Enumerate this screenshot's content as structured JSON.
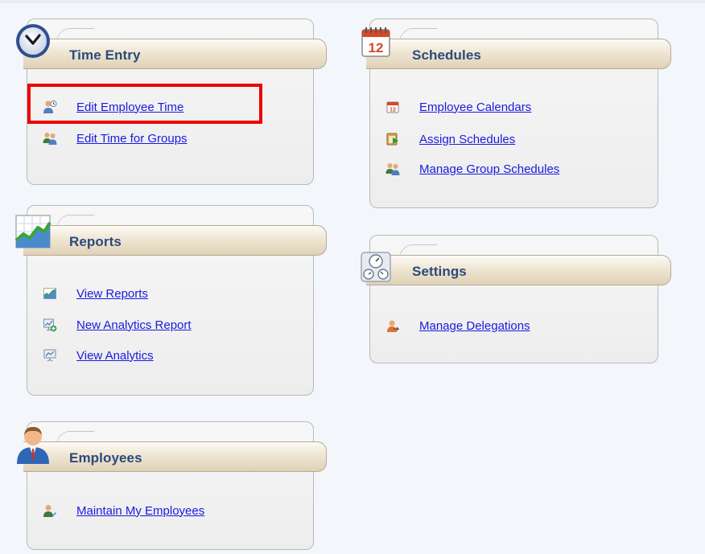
{
  "panels": {
    "time_entry": {
      "title": "Time Entry",
      "icon": "clock-icon",
      "links": [
        {
          "label": "Edit Employee Time",
          "icon": "employee-edit-icon"
        },
        {
          "label": "Edit Time for Groups",
          "icon": "group-icon"
        }
      ]
    },
    "schedules": {
      "title": "Schedules",
      "icon": "calendar-12-icon",
      "links": [
        {
          "label": "Employee Calendars",
          "icon": "calendar-small-icon"
        },
        {
          "label": "Assign Schedules",
          "icon": "assign-schedule-icon"
        },
        {
          "label": "Manage Group Schedules",
          "icon": "group-icon"
        }
      ]
    },
    "reports": {
      "title": "Reports",
      "icon": "chart-icon",
      "links": [
        {
          "label": "View Reports",
          "icon": "chart-small-icon"
        },
        {
          "label": "New Analytics Report",
          "icon": "new-analytics-icon"
        },
        {
          "label": "View Analytics",
          "icon": "analytics-icon"
        }
      ]
    },
    "settings": {
      "title": "Settings",
      "icon": "gauges-icon",
      "links": [
        {
          "label": "Manage Delegations",
          "icon": "delegation-icon"
        }
      ]
    },
    "employees": {
      "title": "Employees",
      "icon": "employee-avatar-icon",
      "links": [
        {
          "label": "Maintain My Employees",
          "icon": "employee-maintain-icon"
        }
      ]
    }
  },
  "colors": {
    "link": "#1a1ae0",
    "title": "#2b4a7c",
    "highlight": "#ee0000"
  }
}
